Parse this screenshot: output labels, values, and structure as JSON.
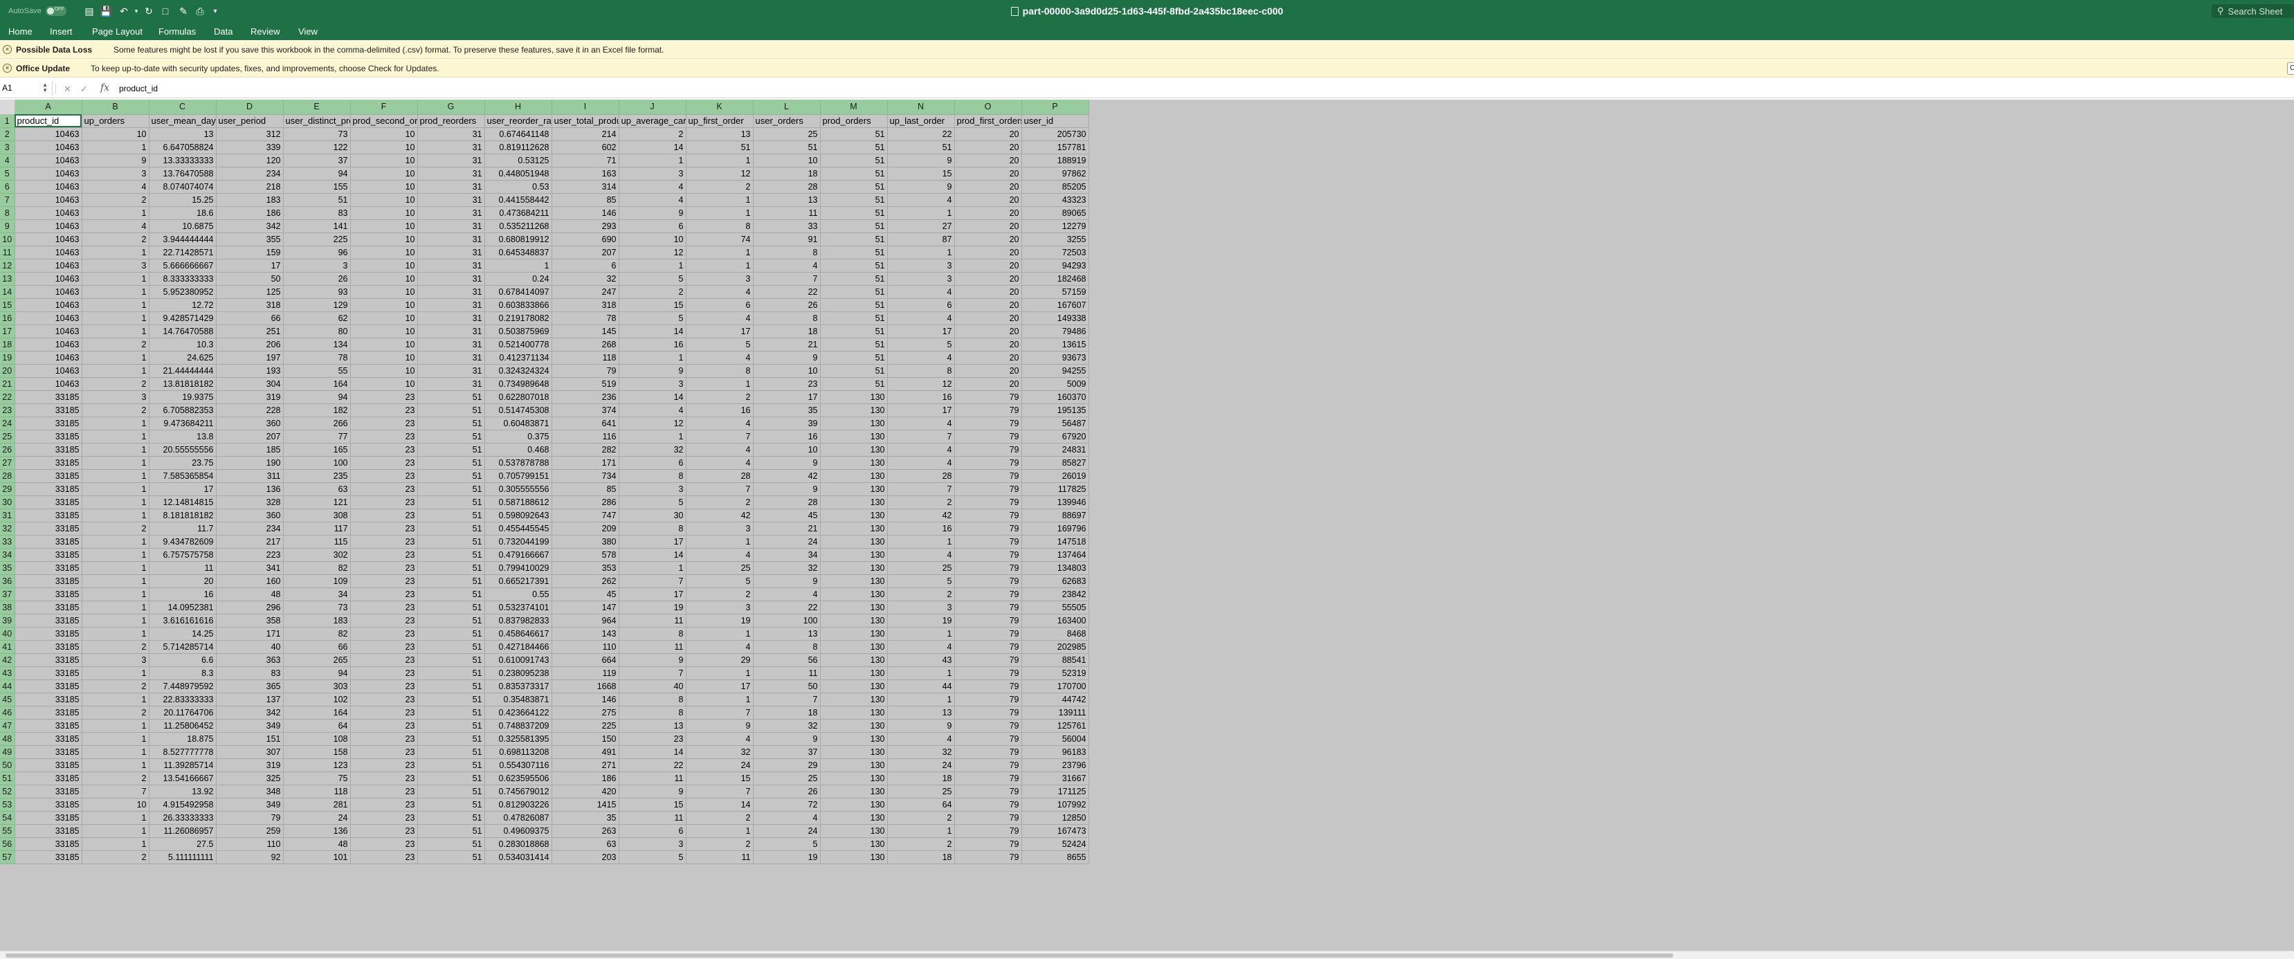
{
  "titlebar": {
    "autosave_label": "AutoSave",
    "autosave_state": "OFF",
    "doc_title": "part-00000-3a9d0d25-1d63-445f-8fbd-2a435bc18eec-c000",
    "search_placeholder": "Search Sheet"
  },
  "ribbon": {
    "tabs": [
      "Home",
      "Insert",
      "Page Layout",
      "Formulas",
      "Data",
      "Review",
      "View"
    ]
  },
  "messages": [
    {
      "title": "Possible Data Loss",
      "text": "Some features might be lost if you save this workbook in the comma-delimited (.csv) format. To preserve these features, save it in an Excel file format."
    },
    {
      "title": "Office Update",
      "text": "To keep up-to-date with security updates, fixes, and improvements, choose Check for Updates."
    }
  ],
  "formula_bar": {
    "name_box": "A1",
    "fx_label": "fx",
    "content": "product_id"
  },
  "grid": {
    "column_letters": [
      "A",
      "B",
      "C",
      "D",
      "E",
      "F",
      "G",
      "H",
      "I",
      "J",
      "K",
      "L",
      "M",
      "N",
      "O",
      "P"
    ],
    "headers": [
      "product_id",
      "up_orders",
      "user_mean_days_since_prior",
      "user_period",
      "user_distinct_products",
      "prod_second_orders",
      "prod_reorders",
      "user_reorder_ratio",
      "user_total_products",
      "up_average_cart_position",
      "up_first_order",
      "user_orders",
      "prod_orders",
      "up_last_order",
      "prod_first_orders",
      "user_id"
    ],
    "rows": [
      [
        "10463",
        "10",
        "13",
        "312",
        "73",
        "10",
        "31",
        "0.674641148",
        "214",
        "2",
        "13",
        "25",
        "51",
        "22",
        "20",
        "205730"
      ],
      [
        "10463",
        "1",
        "6.647058824",
        "339",
        "122",
        "10",
        "31",
        "0.819112628",
        "602",
        "14",
        "51",
        "51",
        "51",
        "51",
        "20",
        "157781"
      ],
      [
        "10463",
        "9",
        "13.33333333",
        "120",
        "37",
        "10",
        "31",
        "0.53125",
        "71",
        "1",
        "1",
        "10",
        "51",
        "9",
        "20",
        "188919"
      ],
      [
        "10463",
        "3",
        "13.76470588",
        "234",
        "94",
        "10",
        "31",
        "0.448051948",
        "163",
        "3",
        "12",
        "18",
        "51",
        "15",
        "20",
        "97862"
      ],
      [
        "10463",
        "4",
        "8.074074074",
        "218",
        "155",
        "10",
        "31",
        "0.53",
        "314",
        "4",
        "2",
        "28",
        "51",
        "9",
        "20",
        "85205"
      ],
      [
        "10463",
        "2",
        "15.25",
        "183",
        "51",
        "10",
        "31",
        "0.441558442",
        "85",
        "4",
        "1",
        "13",
        "51",
        "4",
        "20",
        "43323"
      ],
      [
        "10463",
        "1",
        "18.6",
        "186",
        "83",
        "10",
        "31",
        "0.473684211",
        "146",
        "9",
        "1",
        "11",
        "51",
        "1",
        "20",
        "89065"
      ],
      [
        "10463",
        "4",
        "10.6875",
        "342",
        "141",
        "10",
        "31",
        "0.535211268",
        "293",
        "6",
        "8",
        "33",
        "51",
        "27",
        "20",
        "12279"
      ],
      [
        "10463",
        "2",
        "3.944444444",
        "355",
        "225",
        "10",
        "31",
        "0.680819912",
        "690",
        "10",
        "74",
        "91",
        "51",
        "87",
        "20",
        "3255"
      ],
      [
        "10463",
        "1",
        "22.71428571",
        "159",
        "96",
        "10",
        "31",
        "0.645348837",
        "207",
        "12",
        "1",
        "8",
        "51",
        "1",
        "20",
        "72503"
      ],
      [
        "10463",
        "3",
        "5.666666667",
        "17",
        "3",
        "10",
        "31",
        "1",
        "6",
        "1",
        "1",
        "4",
        "51",
        "3",
        "20",
        "94293"
      ],
      [
        "10463",
        "1",
        "8.333333333",
        "50",
        "26",
        "10",
        "31",
        "0.24",
        "32",
        "5",
        "3",
        "7",
        "51",
        "3",
        "20",
        "182468"
      ],
      [
        "10463",
        "1",
        "5.952380952",
        "125",
        "93",
        "10",
        "31",
        "0.678414097",
        "247",
        "2",
        "4",
        "22",
        "51",
        "4",
        "20",
        "57159"
      ],
      [
        "10463",
        "1",
        "12.72",
        "318",
        "129",
        "10",
        "31",
        "0.603833866",
        "318",
        "15",
        "6",
        "26",
        "51",
        "6",
        "20",
        "167607"
      ],
      [
        "10463",
        "1",
        "9.428571429",
        "66",
        "62",
        "10",
        "31",
        "0.219178082",
        "78",
        "5",
        "4",
        "8",
        "51",
        "4",
        "20",
        "149338"
      ],
      [
        "10463",
        "1",
        "14.76470588",
        "251",
        "80",
        "10",
        "31",
        "0.503875969",
        "145",
        "14",
        "17",
        "18",
        "51",
        "17",
        "20",
        "79486"
      ],
      [
        "10463",
        "2",
        "10.3",
        "206",
        "134",
        "10",
        "31",
        "0.521400778",
        "268",
        "16",
        "5",
        "21",
        "51",
        "5",
        "20",
        "13615"
      ],
      [
        "10463",
        "1",
        "24.625",
        "197",
        "78",
        "10",
        "31",
        "0.412371134",
        "118",
        "1",
        "4",
        "9",
        "51",
        "4",
        "20",
        "93673"
      ],
      [
        "10463",
        "1",
        "21.44444444",
        "193",
        "55",
        "10",
        "31",
        "0.324324324",
        "79",
        "9",
        "8",
        "10",
        "51",
        "8",
        "20",
        "94255"
      ],
      [
        "10463",
        "2",
        "13.81818182",
        "304",
        "164",
        "10",
        "31",
        "0.734989648",
        "519",
        "3",
        "1",
        "23",
        "51",
        "12",
        "20",
        "5009"
      ],
      [
        "33185",
        "3",
        "19.9375",
        "319",
        "94",
        "23",
        "51",
        "0.622807018",
        "236",
        "14",
        "2",
        "17",
        "130",
        "16",
        "79",
        "160370"
      ],
      [
        "33185",
        "2",
        "6.705882353",
        "228",
        "182",
        "23",
        "51",
        "0.514745308",
        "374",
        "4",
        "16",
        "35",
        "130",
        "17",
        "79",
        "195135"
      ],
      [
        "33185",
        "1",
        "9.473684211",
        "360",
        "266",
        "23",
        "51",
        "0.60483871",
        "641",
        "12",
        "4",
        "39",
        "130",
        "4",
        "79",
        "56487"
      ],
      [
        "33185",
        "1",
        "13.8",
        "207",
        "77",
        "23",
        "51",
        "0.375",
        "116",
        "1",
        "7",
        "16",
        "130",
        "7",
        "79",
        "67920"
      ],
      [
        "33185",
        "1",
        "20.55555556",
        "185",
        "165",
        "23",
        "51",
        "0.468",
        "282",
        "32",
        "4",
        "10",
        "130",
        "4",
        "79",
        "24831"
      ],
      [
        "33185",
        "1",
        "23.75",
        "190",
        "100",
        "23",
        "51",
        "0.537878788",
        "171",
        "6",
        "4",
        "9",
        "130",
        "4",
        "79",
        "85827"
      ],
      [
        "33185",
        "1",
        "7.585365854",
        "311",
        "235",
        "23",
        "51",
        "0.705799151",
        "734",
        "8",
        "28",
        "42",
        "130",
        "28",
        "79",
        "26019"
      ],
      [
        "33185",
        "1",
        "17",
        "136",
        "63",
        "23",
        "51",
        "0.305555556",
        "85",
        "3",
        "7",
        "9",
        "130",
        "7",
        "79",
        "117825"
      ],
      [
        "33185",
        "1",
        "12.14814815",
        "328",
        "121",
        "23",
        "51",
        "0.587188612",
        "286",
        "5",
        "2",
        "28",
        "130",
        "2",
        "79",
        "139946"
      ],
      [
        "33185",
        "1",
        "8.181818182",
        "360",
        "308",
        "23",
        "51",
        "0.598092643",
        "747",
        "30",
        "42",
        "45",
        "130",
        "42",
        "79",
        "88697"
      ],
      [
        "33185",
        "2",
        "11.7",
        "234",
        "117",
        "23",
        "51",
        "0.455445545",
        "209",
        "8",
        "3",
        "21",
        "130",
        "16",
        "79",
        "169796"
      ],
      [
        "33185",
        "1",
        "9.434782609",
        "217",
        "115",
        "23",
        "51",
        "0.732044199",
        "380",
        "17",
        "1",
        "24",
        "130",
        "1",
        "79",
        "147518"
      ],
      [
        "33185",
        "1",
        "6.757575758",
        "223",
        "302",
        "23",
        "51",
        "0.479166667",
        "578",
        "14",
        "4",
        "34",
        "130",
        "4",
        "79",
        "137464"
      ],
      [
        "33185",
        "1",
        "11",
        "341",
        "82",
        "23",
        "51",
        "0.799410029",
        "353",
        "1",
        "25",
        "32",
        "130",
        "25",
        "79",
        "134803"
      ],
      [
        "33185",
        "1",
        "20",
        "160",
        "109",
        "23",
        "51",
        "0.665217391",
        "262",
        "7",
        "5",
        "9",
        "130",
        "5",
        "79",
        "62683"
      ],
      [
        "33185",
        "1",
        "16",
        "48",
        "34",
        "23",
        "51",
        "0.55",
        "45",
        "17",
        "2",
        "4",
        "130",
        "2",
        "79",
        "23842"
      ],
      [
        "33185",
        "1",
        "14.0952381",
        "296",
        "73",
        "23",
        "51",
        "0.532374101",
        "147",
        "19",
        "3",
        "22",
        "130",
        "3",
        "79",
        "55505"
      ],
      [
        "33185",
        "1",
        "3.616161616",
        "358",
        "183",
        "23",
        "51",
        "0.837982833",
        "964",
        "11",
        "19",
        "100",
        "130",
        "19",
        "79",
        "163400"
      ],
      [
        "33185",
        "1",
        "14.25",
        "171",
        "82",
        "23",
        "51",
        "0.458646617",
        "143",
        "8",
        "1",
        "13",
        "130",
        "1",
        "79",
        "8468"
      ],
      [
        "33185",
        "2",
        "5.714285714",
        "40",
        "66",
        "23",
        "51",
        "0.427184466",
        "110",
        "11",
        "4",
        "8",
        "130",
        "4",
        "79",
        "202985"
      ],
      [
        "33185",
        "3",
        "6.6",
        "363",
        "265",
        "23",
        "51",
        "0.610091743",
        "664",
        "9",
        "29",
        "56",
        "130",
        "43",
        "79",
        "88541"
      ],
      [
        "33185",
        "1",
        "8.3",
        "83",
        "94",
        "23",
        "51",
        "0.238095238",
        "119",
        "7",
        "1",
        "11",
        "130",
        "1",
        "79",
        "52319"
      ],
      [
        "33185",
        "2",
        "7.448979592",
        "365",
        "303",
        "23",
        "51",
        "0.835373317",
        "1668",
        "40",
        "17",
        "50",
        "130",
        "44",
        "79",
        "170700"
      ],
      [
        "33185",
        "1",
        "22.83333333",
        "137",
        "102",
        "23",
        "51",
        "0.35483871",
        "146",
        "8",
        "1",
        "7",
        "130",
        "1",
        "79",
        "44742"
      ],
      [
        "33185",
        "2",
        "20.11764706",
        "342",
        "164",
        "23",
        "51",
        "0.423664122",
        "275",
        "8",
        "7",
        "18",
        "130",
        "13",
        "79",
        "139111"
      ],
      [
        "33185",
        "1",
        "11.25806452",
        "349",
        "64",
        "23",
        "51",
        "0.748837209",
        "225",
        "13",
        "9",
        "32",
        "130",
        "9",
        "79",
        "125761"
      ],
      [
        "33185",
        "1",
        "18.875",
        "151",
        "108",
        "23",
        "51",
        "0.325581395",
        "150",
        "23",
        "4",
        "9",
        "130",
        "4",
        "79",
        "56004"
      ],
      [
        "33185",
        "1",
        "8.527777778",
        "307",
        "158",
        "23",
        "51",
        "0.698113208",
        "491",
        "14",
        "32",
        "37",
        "130",
        "32",
        "79",
        "96183"
      ],
      [
        "33185",
        "1",
        "11.39285714",
        "319",
        "123",
        "23",
        "51",
        "0.554307116",
        "271",
        "22",
        "24",
        "29",
        "130",
        "24",
        "79",
        "23796"
      ],
      [
        "33185",
        "2",
        "13.54166667",
        "325",
        "75",
        "23",
        "51",
        "0.623595506",
        "186",
        "11",
        "15",
        "25",
        "130",
        "18",
        "79",
        "31667"
      ],
      [
        "33185",
        "7",
        "13.92",
        "348",
        "118",
        "23",
        "51",
        "0.745679012",
        "420",
        "9",
        "7",
        "26",
        "130",
        "25",
        "79",
        "171125"
      ],
      [
        "33185",
        "10",
        "4.915492958",
        "349",
        "281",
        "23",
        "51",
        "0.812903226",
        "1415",
        "15",
        "14",
        "72",
        "130",
        "64",
        "79",
        "107992"
      ],
      [
        "33185",
        "1",
        "26.33333333",
        "79",
        "24",
        "23",
        "51",
        "0.47826087",
        "35",
        "11",
        "2",
        "4",
        "130",
        "2",
        "79",
        "12850"
      ],
      [
        "33185",
        "1",
        "11.26086957",
        "259",
        "136",
        "23",
        "51",
        "0.49609375",
        "263",
        "6",
        "1",
        "24",
        "130",
        "1",
        "79",
        "167473"
      ],
      [
        "33185",
        "1",
        "27.5",
        "110",
        "48",
        "23",
        "51",
        "0.283018868",
        "63",
        "3",
        "2",
        "5",
        "130",
        "2",
        "79",
        "52424"
      ],
      [
        "33185",
        "2",
        "5.111111111",
        "92",
        "101",
        "23",
        "51",
        "0.534031414",
        "203",
        "5",
        "11",
        "19",
        "130",
        "18",
        "79",
        "8655"
      ]
    ]
  },
  "colors": {
    "brand_green": "#1e7145",
    "header_green": "#98cc9f",
    "selection_gray": "#c6c6c6",
    "message_bar": "#fdf6d3"
  }
}
